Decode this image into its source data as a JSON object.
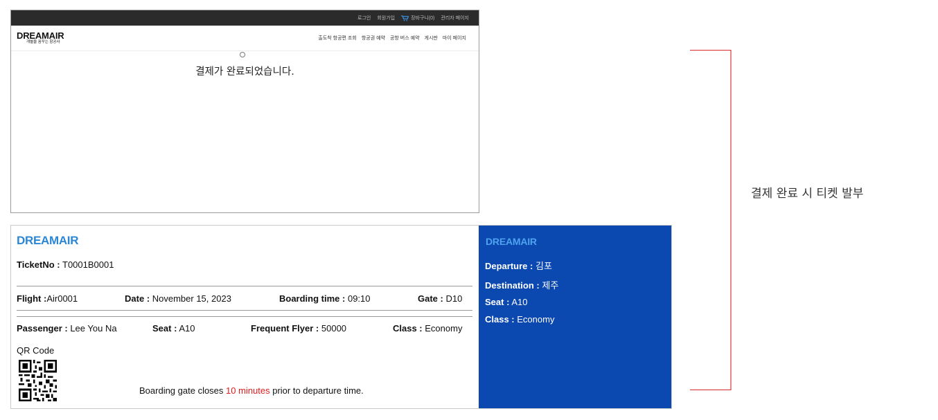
{
  "header": {
    "links": [
      "로그인",
      "회원가입",
      "장바구니(0)",
      "관리자 페이지"
    ],
    "cart_icon": "cart-icon"
  },
  "logo": {
    "main": "DREAMAIR",
    "sub": "개별을 꿈꾸는 항공사"
  },
  "nav": {
    "items": [
      "출도착 항공편 조회",
      "항공권 예약",
      "공항 버스 예약",
      "게시판",
      "마이 페이지"
    ]
  },
  "main": {
    "message": "결제가 완료되었습니다."
  },
  "ticket": {
    "brand": "DREAMAIR",
    "ticket_no_label": "TicketNo :",
    "ticket_no": "T0001B0001",
    "flight_label": "Flight :",
    "flight": "Air0001",
    "date_label": "Date :",
    "date": "November 15, 2023",
    "boarding_label": "Boarding time :",
    "boarding": "09:10",
    "gate_label": "Gate :",
    "gate": "D10",
    "passenger_label": "Passenger :",
    "passenger": "Lee You Na",
    "seat_label": "Seat :",
    "seat": "A10",
    "ff_label": "Frequent Flyer :",
    "ff": "50000",
    "class_label": "Class :",
    "class": "Economy",
    "qr_label": "QR Code",
    "notice_pre": "Boarding gate closes ",
    "notice_highlight": "10 minutes",
    "notice_post": " prior to departure time.",
    "stub": {
      "brand": "DREAMAIR",
      "departure_label": "Departure :",
      "departure": "김포",
      "destination_label": "Destination :",
      "destination": "제주",
      "seat_label": "Seat :",
      "seat": "A10",
      "class_label": "Class :",
      "class": "Economy"
    }
  },
  "annotation": {
    "label": "결제 완료 시 티켓 발부"
  },
  "colors": {
    "stub_bg": "#0b48b0",
    "brand_blue": "#2b86d6",
    "highlight_red": "#e01c1c",
    "bracket": "#d9383a"
  }
}
